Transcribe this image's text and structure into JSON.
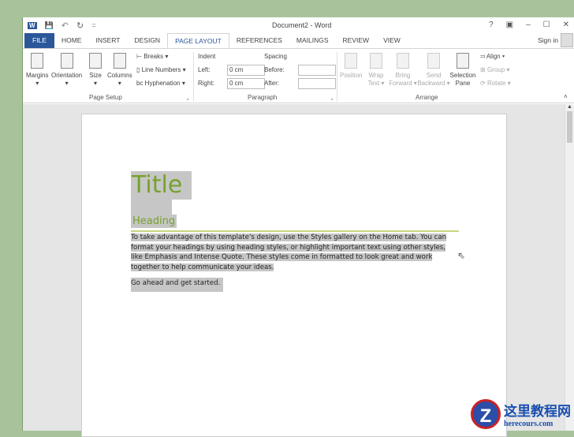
{
  "window": {
    "title": "Document2 - Word",
    "help": "?",
    "minimize": "–",
    "maximize": "☐",
    "close": "✕",
    "sign_in": "Sign in"
  },
  "quick_access": {
    "word": "W",
    "save": "💾",
    "undo": "↶",
    "redo": "↻",
    "customize": "="
  },
  "tabs": [
    "FILE",
    "HOME",
    "INSERT",
    "DESIGN",
    "PAGE LAYOUT",
    "REFERENCES",
    "MAILINGS",
    "REVIEW",
    "VIEW"
  ],
  "ribbon": {
    "page_setup": {
      "group": "Page Setup",
      "margins": "Margins",
      "orientation": "Orientation",
      "size": "Size",
      "columns": "Columns",
      "breaks": "Breaks ▾",
      "line_numbers": "Line Numbers ▾",
      "hyphenation": "Hyphenation ▾"
    },
    "paragraph": {
      "group": "Paragraph",
      "indent": "Indent",
      "left_label": "Left:",
      "left_value": "0 cm",
      "right_label": "Right:",
      "right_value": "0 cm",
      "spacing": "Spacing",
      "before_label": "Before:",
      "before_value": "",
      "after_label": "After:",
      "after_value": ""
    },
    "arrange": {
      "group": "Arrange",
      "position": "Position",
      "wrap_text": "Wrap Text ▾",
      "bring_forward": "Bring Forward ▾",
      "send_backward": "Send Backward ▾",
      "selection_pane": "Selection Pane",
      "align": "Align ▾",
      "group_btn": "Group ▾",
      "rotate": "Rotate ▾"
    }
  },
  "document": {
    "title": "Title",
    "heading": "Heading",
    "paragraph": "To take advantage of this template's design, use the Styles gallery on the Home tab. You can format your headings by using heading styles, or highlight important text using other styles, like Emphasis and Intense Quote. These styles come in formatted to look great and work together to help communicate your ideas.",
    "paragraph2": "Go ahead and get started."
  },
  "watermark": {
    "text": "这里教程网",
    "url": "herecours.com",
    "logo": "Z"
  }
}
